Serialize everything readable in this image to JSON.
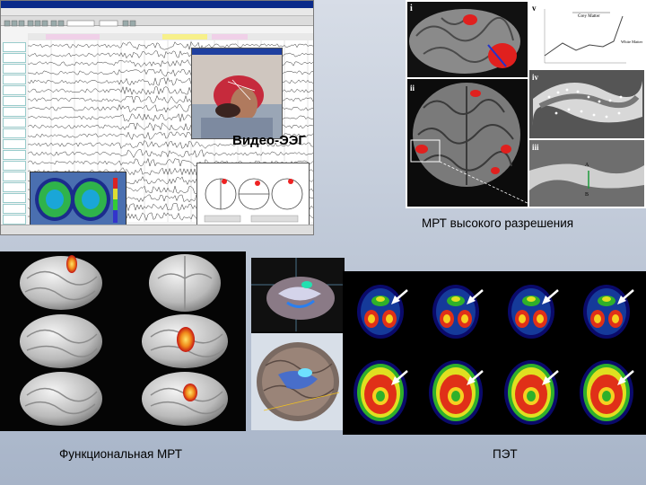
{
  "captions": {
    "eeg": "Видео-ЭЭГ",
    "mri": "МРТ высокого разрешения",
    "fmri": "Функциональная МРТ",
    "pet": "ПЭТ"
  },
  "mri_panel_labels": {
    "i": "i",
    "ii": "ii",
    "iii": "iii",
    "iv": "iv",
    "v": "v",
    "grey_matter": "Grey Matter",
    "white_matter": "White Matter",
    "marker_a": "A",
    "marker_b": "B"
  },
  "colors": {
    "background_top": "#d7dde7",
    "background_bottom": "#a7b4c8",
    "activation": "#e0201e",
    "hot_spot": "#f4c21a"
  }
}
